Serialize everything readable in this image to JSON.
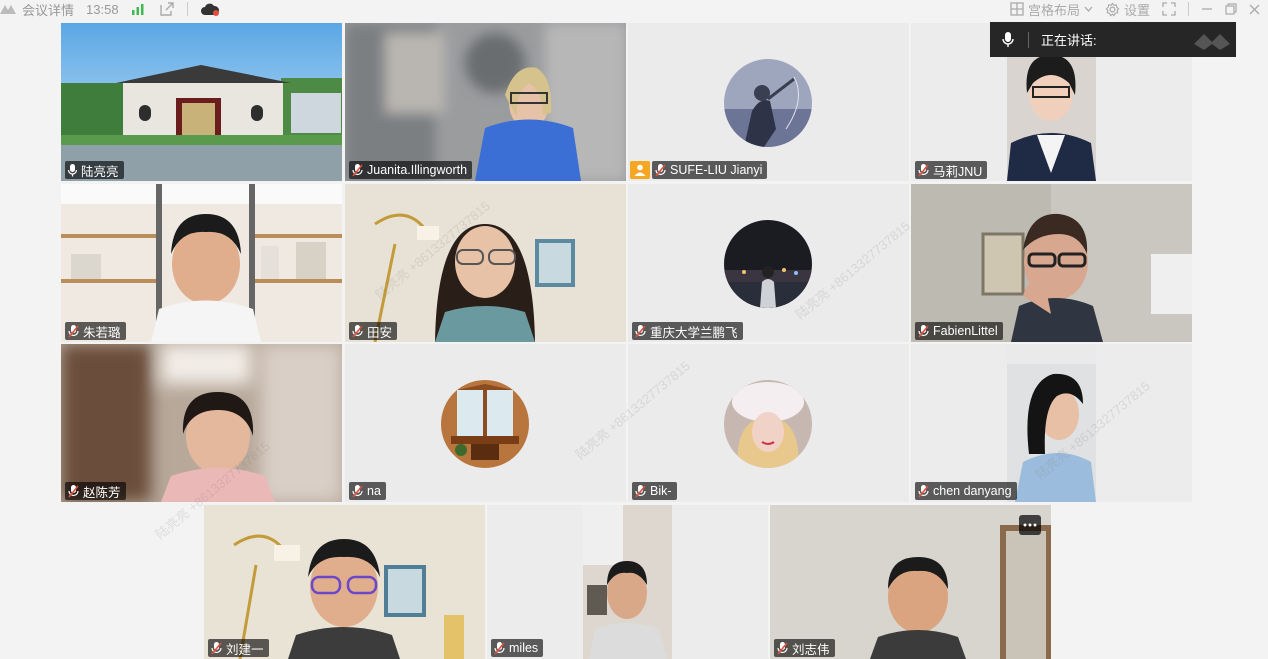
{
  "topbar": {
    "title": "会议详情",
    "time": "13:58",
    "layout_label": "宫格布局",
    "settings_label": "设置"
  },
  "speaking": {
    "label": "正在讲话:"
  },
  "participants": [
    {
      "name": "陆亮亮",
      "mic": "on"
    },
    {
      "name": "Juanita.Illingworth",
      "mic": "muted"
    },
    {
      "name": "SUFE-LIU Jianyi",
      "mic": "muted",
      "host": true
    },
    {
      "name": "马莉JNU",
      "mic": "muted"
    },
    {
      "name": "朱若璐",
      "mic": "muted"
    },
    {
      "name": "田安",
      "mic": "muted"
    },
    {
      "name": "重庆大学兰鹏飞",
      "mic": "muted"
    },
    {
      "name": "FabienLittel",
      "mic": "muted"
    },
    {
      "name": "赵陈芳",
      "mic": "muted"
    },
    {
      "name": "na",
      "mic": "muted"
    },
    {
      "name": "Bik-",
      "mic": "muted"
    },
    {
      "name": "chen danyang",
      "mic": "muted"
    },
    {
      "name": "刘建一",
      "mic": "muted"
    },
    {
      "name": "miles",
      "mic": "muted"
    },
    {
      "name": "刘志伟",
      "mic": "muted"
    }
  ],
  "watermark": "陆亮亮 +8613327737815",
  "colors": {
    "accent": "#f5a623",
    "mic_muted": "#e0503f",
    "speaking_bg": "#262626",
    "signal": "#3fb950"
  }
}
